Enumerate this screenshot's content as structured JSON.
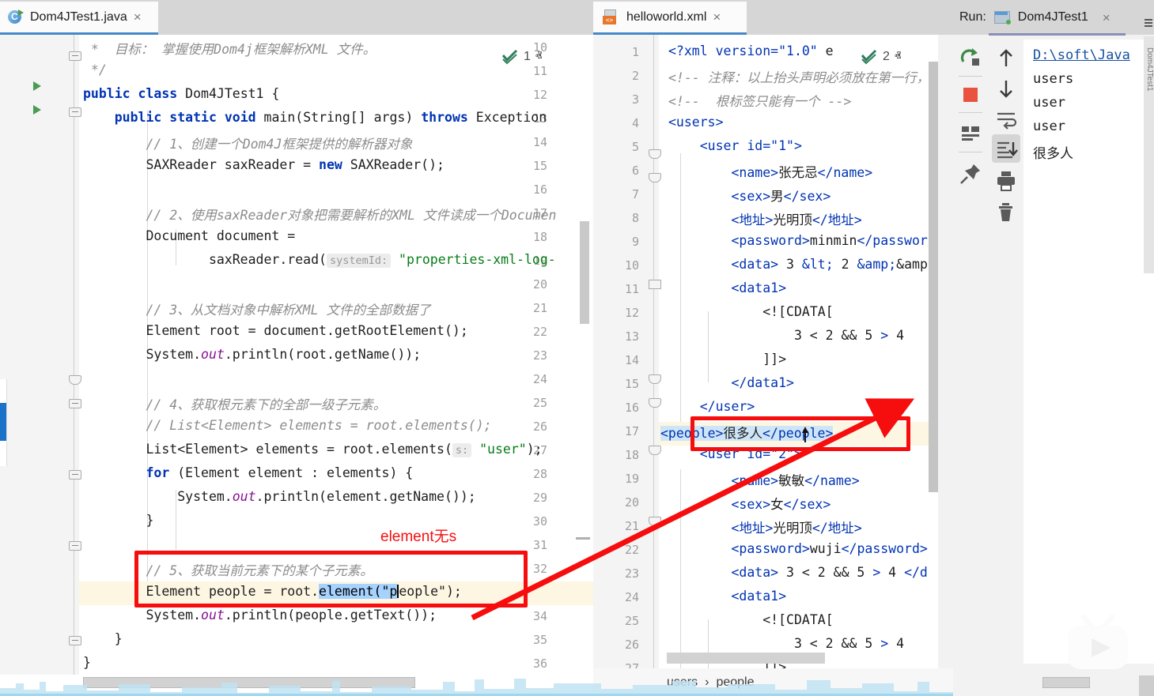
{
  "app": {
    "ide": "IntelliJ IDEA"
  },
  "java_tab": {
    "label": "Dom4JTest1.java",
    "close": "×",
    "icon": "java-class-icon",
    "badge_char": "C"
  },
  "java_inspection": {
    "count": "1",
    "up": "ⱏ",
    "down": "ⱟ"
  },
  "java_editor": {
    "first_line_no": 10,
    "lines": [
      {
        "no": 10,
        "segments": [
          {
            "t": " *  目标： 掌握使用Dom4j框架解析XML 文件。",
            "c": "cmt"
          }
        ]
      },
      {
        "no": 11,
        "segments": [
          {
            "t": " */",
            "c": "cmt"
          }
        ]
      },
      {
        "no": 12,
        "segments": [
          {
            "t": "public",
            "c": "kw"
          },
          {
            "t": " ",
            "c": "plain"
          },
          {
            "t": "class",
            "c": "kw"
          },
          {
            "t": " Dom4JTest1 {",
            "c": "plain"
          }
        ]
      },
      {
        "no": 13,
        "segments": [
          {
            "t": "    ",
            "c": "plain"
          },
          {
            "t": "public",
            "c": "kw"
          },
          {
            "t": " ",
            "c": "plain"
          },
          {
            "t": "static",
            "c": "kw"
          },
          {
            "t": " ",
            "c": "plain"
          },
          {
            "t": "void",
            "c": "kw"
          },
          {
            "t": " main(String[] args) ",
            "c": "plain"
          },
          {
            "t": "throws",
            "c": "kw"
          },
          {
            "t": " Exception",
            "c": "plain"
          }
        ]
      },
      {
        "no": 14,
        "segments": [
          {
            "t": "        // 1、创建一个Dom4J框架提供的解析器对象",
            "c": "cmt"
          }
        ]
      },
      {
        "no": 15,
        "segments": [
          {
            "t": "        SAXReader saxReader = ",
            "c": "plain"
          },
          {
            "t": "new",
            "c": "kw"
          },
          {
            "t": " SAXReader();",
            "c": "plain"
          }
        ]
      },
      {
        "no": 16,
        "segments": []
      },
      {
        "no": 17,
        "segments": [
          {
            "t": "        // 2、使用saxReader对象把需要解析的XML 文件读成一个Documen",
            "c": "cmt"
          }
        ]
      },
      {
        "no": 18,
        "segments": [
          {
            "t": "        Document document =",
            "c": "plain"
          }
        ]
      },
      {
        "no": 19,
        "segments": [
          {
            "t": "                saxReader.read(",
            "c": "plain"
          },
          {
            "t": "systemId:",
            "c": "hint"
          },
          {
            "t": " ",
            "c": "plain"
          },
          {
            "t": "\"properties-xml-log-",
            "c": "str"
          }
        ]
      },
      {
        "no": 20,
        "segments": []
      },
      {
        "no": 21,
        "segments": [
          {
            "t": "        // 3、从文档对象中解析XML 文件的全部数据了",
            "c": "cmt"
          }
        ]
      },
      {
        "no": 22,
        "segments": [
          {
            "t": "        Element root = document.getRootElement();",
            "c": "plain"
          }
        ]
      },
      {
        "no": 23,
        "segments": [
          {
            "t": "        System.",
            "c": "plain"
          },
          {
            "t": "out",
            "c": "fld"
          },
          {
            "t": ".println(root.getName());",
            "c": "plain"
          }
        ]
      },
      {
        "no": 24,
        "segments": []
      },
      {
        "no": 25,
        "segments": [
          {
            "t": "        // 4、获取根元素下的全部一级子元素。",
            "c": "cmt"
          }
        ]
      },
      {
        "no": 26,
        "segments": [
          {
            "t": "        // List<Element> elements = root.elements();",
            "c": "cmt"
          }
        ]
      },
      {
        "no": 27,
        "segments": [
          {
            "t": "        List<Element> elements = root.elements(",
            "c": "plain"
          },
          {
            "t": "s:",
            "c": "hint"
          },
          {
            "t": " ",
            "c": "plain"
          },
          {
            "t": "\"user\"",
            "c": "str"
          },
          {
            "t": ");",
            "c": "plain"
          }
        ]
      },
      {
        "no": 28,
        "segments": [
          {
            "t": "        ",
            "c": "plain"
          },
          {
            "t": "for",
            "c": "kw"
          },
          {
            "t": " (Element element : elements) {",
            "c": "plain"
          }
        ]
      },
      {
        "no": 29,
        "segments": [
          {
            "t": "            System.",
            "c": "plain"
          },
          {
            "t": "out",
            "c": "fld"
          },
          {
            "t": ".println(element.getName());",
            "c": "plain"
          }
        ]
      },
      {
        "no": 30,
        "segments": [
          {
            "t": "        }",
            "c": "plain"
          }
        ]
      },
      {
        "no": 31,
        "segments": []
      },
      {
        "no": 32,
        "segments": [
          {
            "t": "        // 5、获取当前元素下的某个子元素。",
            "c": "cmt"
          }
        ]
      },
      {
        "no": 33,
        "segments": [
          {
            "t": "        Element people = root.",
            "c": "plain"
          },
          {
            "t": "element(\"p",
            "c": "sel"
          },
          {
            "t": "|",
            "c": "caret"
          },
          {
            "t": "eople\");",
            "c": "plain"
          }
        ]
      },
      {
        "no": 34,
        "segments": [
          {
            "t": "        System.",
            "c": "plain"
          },
          {
            "t": "out",
            "c": "fld"
          },
          {
            "t": ".println(people.getText());",
            "c": "plain"
          }
        ]
      },
      {
        "no": 35,
        "segments": [
          {
            "t": "    }",
            "c": "plain"
          }
        ]
      },
      {
        "no": 36,
        "segments": [
          {
            "t": "}",
            "c": "plain"
          }
        ]
      },
      {
        "no": 37,
        "segments": []
      }
    ],
    "annotation": "element无s",
    "selected_text": "element(\"p",
    "highlighted_line_no": 33
  },
  "xml_tab": {
    "label": "helloworld.xml",
    "close": "×",
    "icon": "xml-file-icon",
    "tag_glyph": "<>"
  },
  "xml_inspection": {
    "count": "2",
    "up": "ⱏ",
    "down": "ⱟ"
  },
  "xml_editor": {
    "lines": [
      {
        "no": 1,
        "text": "<?xml version=\"1.0\" e"
      },
      {
        "no": 2,
        "text": "<!-- 注释：以上抬头声明必须放在第一行，"
      },
      {
        "no": 3,
        "text": "<!--  根标签只能有一个 -->"
      },
      {
        "no": 4,
        "text": "<users>"
      },
      {
        "no": 5,
        "text": "    <user id=\"1\">"
      },
      {
        "no": 6,
        "text": "        <name>张无忌</name>"
      },
      {
        "no": 7,
        "text": "        <sex>男</sex>"
      },
      {
        "no": 8,
        "text": "        <地址>光明顶</地址>"
      },
      {
        "no": 9,
        "text": "        <password>minmin</passwor"
      },
      {
        "no": 10,
        "text": "        <data> 3 &lt; 2 &amp;&amp"
      },
      {
        "no": 11,
        "text": "        <data1>"
      },
      {
        "no": 12,
        "text": "            <![CDATA["
      },
      {
        "no": 13,
        "text": "                3 < 2 && 5 > 4"
      },
      {
        "no": 14,
        "text": "            ]]>"
      },
      {
        "no": 15,
        "text": "        </data1>"
      },
      {
        "no": 16,
        "text": "    </user>"
      },
      {
        "no": 17,
        "text": "    <people>很多人</people>"
      },
      {
        "no": 18,
        "text": "    <user id=\"2\">"
      },
      {
        "no": 19,
        "text": "        <name>敏敏</name>"
      },
      {
        "no": 20,
        "text": "        <sex>女</sex>"
      },
      {
        "no": 21,
        "text": "        <地址>光明顶</地址>"
      },
      {
        "no": 22,
        "text": "        <password>wuji</password>"
      },
      {
        "no": 23,
        "text": "        <data> 3 < 2 && 5 > 4 </d"
      },
      {
        "no": 24,
        "text": "        <data1>"
      },
      {
        "no": 25,
        "text": "            <![CDATA["
      },
      {
        "no": 26,
        "text": "                3 < 2 && 5 > 4"
      },
      {
        "no": 27,
        "text": "            ]]>"
      }
    ],
    "highlighted_line_no": 17,
    "highlighted_text": "<people>很多人</people>"
  },
  "breadcrumb": {
    "items": [
      "users",
      "people"
    ],
    "separator": "›"
  },
  "run_panel": {
    "label": "Run:",
    "config_name": "Dom4JTest1",
    "close": "×",
    "side_label": "Dom4JTest1",
    "toolbar_left": [
      {
        "name": "rerun-icon",
        "label": "Rerun"
      },
      {
        "name": "stop-icon",
        "label": "Stop"
      },
      {
        "name": "console-layout-icon",
        "label": "Console"
      },
      {
        "name": "pin-icon",
        "label": "Pin Tab"
      }
    ],
    "toolbar_right": [
      {
        "name": "up-arrow-icon",
        "label": "Up the stack trace"
      },
      {
        "name": "down-arrow-icon",
        "label": "Down the stack trace"
      },
      {
        "name": "soft-wrap-icon",
        "label": "Soft-Wrap"
      },
      {
        "name": "scroll-to-end-icon",
        "label": "Scroll to the end"
      },
      {
        "name": "print-icon",
        "label": "Print"
      },
      {
        "name": "trash-icon",
        "label": "Clear All"
      }
    ],
    "console_output": [
      {
        "text": "D:\\soft\\Java",
        "link": true
      },
      {
        "text": "users",
        "link": false
      },
      {
        "text": "user",
        "link": false
      },
      {
        "text": "user",
        "link": false
      },
      {
        "text": "很多人",
        "link": false
      }
    ]
  },
  "colors": {
    "accent_blue": "#4588c8",
    "annotation_red": "#f60d0d",
    "keyword": "#0033b3",
    "string": "#067d17",
    "comment": "#8c8c8c",
    "selection": "#a6d2ff",
    "line_highlight": "#fdf6e3",
    "console_link": "#1750a0"
  }
}
